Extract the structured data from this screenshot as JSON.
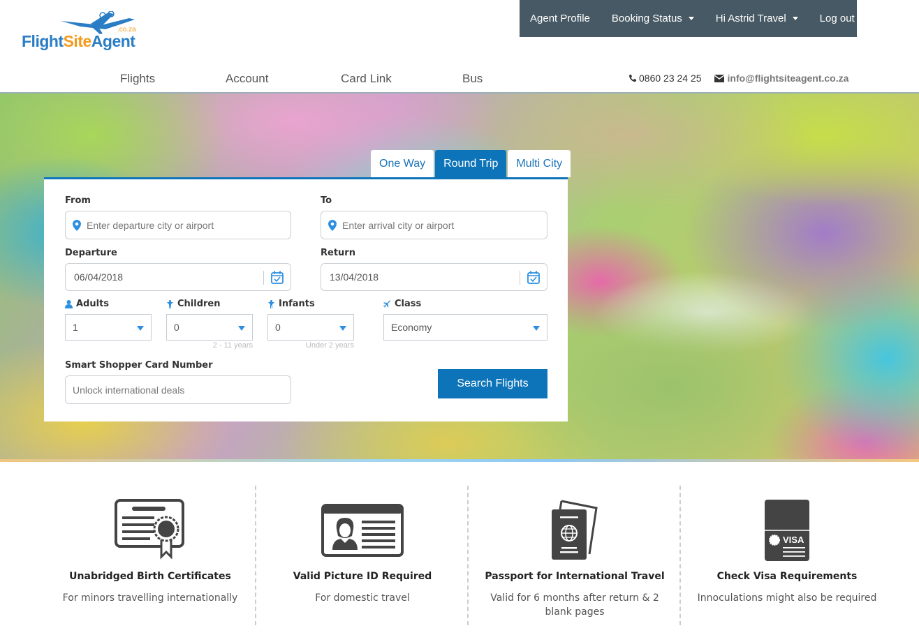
{
  "brand": {
    "name_part1": "Flight",
    "name_part2": "Site",
    "name_part3": "Agent",
    "domain_suffix": ".co.za",
    "primary_color": "#2a7dc4",
    "accent_color": "#f39a1c"
  },
  "topbar": {
    "items": [
      {
        "label": "Agent Profile",
        "dropdown": false
      },
      {
        "label": "Booking Status",
        "dropdown": true
      },
      {
        "label": "Hi Astrid Travel",
        "dropdown": true
      },
      {
        "label": "Log out",
        "dropdown": false
      }
    ],
    "background": "#475964"
  },
  "nav": {
    "items": [
      {
        "label": "Flights"
      },
      {
        "label": "Account"
      },
      {
        "label": "Card Link"
      },
      {
        "label": "Bus"
      }
    ]
  },
  "contact": {
    "phone_icon": "phone-icon",
    "phone": "0860 23 24 25",
    "email_icon": "envelope-icon",
    "email": "info@flightsiteagent.co.za"
  },
  "search": {
    "tabs": [
      {
        "label": "One Way",
        "active": false
      },
      {
        "label": "Round Trip",
        "active": true
      },
      {
        "label": "Multi City",
        "active": false
      }
    ],
    "from": {
      "label": "From",
      "placeholder": "Enter departure city or airport",
      "icon": "map-marker-icon"
    },
    "to": {
      "label": "To",
      "placeholder": "Enter arrival city or airport",
      "icon": "map-marker-icon"
    },
    "departure": {
      "label": "Departure",
      "value": "06/04/2018",
      "icon": "calendar-check-icon"
    },
    "return": {
      "label": "Return",
      "value": "13/04/2018",
      "icon": "calendar-check-icon"
    },
    "adults": {
      "label": "Adults",
      "value": "1",
      "icon": "user-icon"
    },
    "children": {
      "label": "Children",
      "value": "0",
      "hint": "2 - 11 years",
      "icon": "child-icon"
    },
    "infants": {
      "label": "Infants",
      "value": "0",
      "hint": "Under 2 years",
      "icon": "child-icon"
    },
    "class": {
      "label": "Class",
      "value": "Economy",
      "icon": "plane-icon"
    },
    "smart_shopper": {
      "label": "Smart Shopper Card Number",
      "placeholder": "Unlock international deals"
    },
    "submit_label": "Search Flights",
    "accent": "#0e74b9"
  },
  "requirements": [
    {
      "icon": "certificate-icon",
      "title": "Unabridged Birth Certificates",
      "description": "For minors travelling internationally"
    },
    {
      "icon": "id-card-icon",
      "title": "Valid Picture ID Required",
      "description": "For domestic travel"
    },
    {
      "icon": "passport-icon",
      "title": "Passport for International Travel",
      "description": "Valid for 6 months after return & 2 blank pages"
    },
    {
      "icon": "visa-icon",
      "title": "Check Visa Requirements",
      "description": "Innoculations might also be required",
      "badge_text": "VISA"
    }
  ]
}
